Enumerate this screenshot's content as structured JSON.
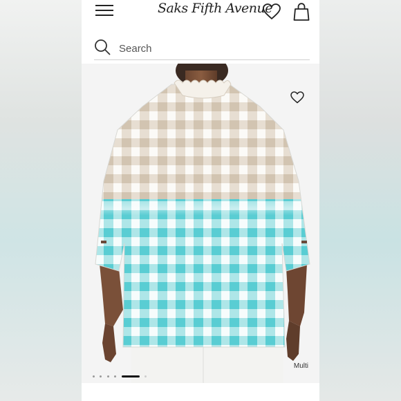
{
  "header": {
    "logo_text": "Saks Fifth Avenue",
    "menu_icon": "hamburger-menu-icon",
    "wishlist_icon": "heart-icon",
    "bag_icon": "shopping-bag-icon"
  },
  "search": {
    "placeholder": "Search",
    "icon": "search-icon"
  },
  "product": {
    "color_label": "Multi",
    "image_count": 6,
    "active_image": 5,
    "wishlist_icon": "heart-outline-icon"
  },
  "colors": {
    "gingham_tan": "#d9cdbd",
    "gingham_aqua": "#6fd3d8",
    "background": "#ffffff"
  }
}
